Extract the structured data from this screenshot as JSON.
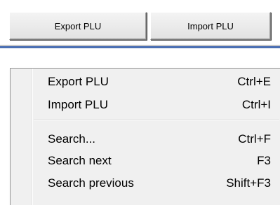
{
  "toolbar": {
    "export_button": "Export PLU",
    "import_button": "Import PLU"
  },
  "menu": {
    "items": [
      {
        "label": "Export PLU",
        "shortcut": "Ctrl+E"
      },
      {
        "label": "Import PLU",
        "shortcut": "Ctrl+I"
      },
      {
        "label": "Search...",
        "shortcut": "Ctrl+F"
      },
      {
        "label": "Search next",
        "shortcut": "F3"
      },
      {
        "label": "Search previous",
        "shortcut": "Shift+F3"
      }
    ]
  },
  "colors": {
    "accent_line": "#4a6fb3",
    "menu_background": "#f0f0f0",
    "button_face": "#e8e8e8"
  }
}
